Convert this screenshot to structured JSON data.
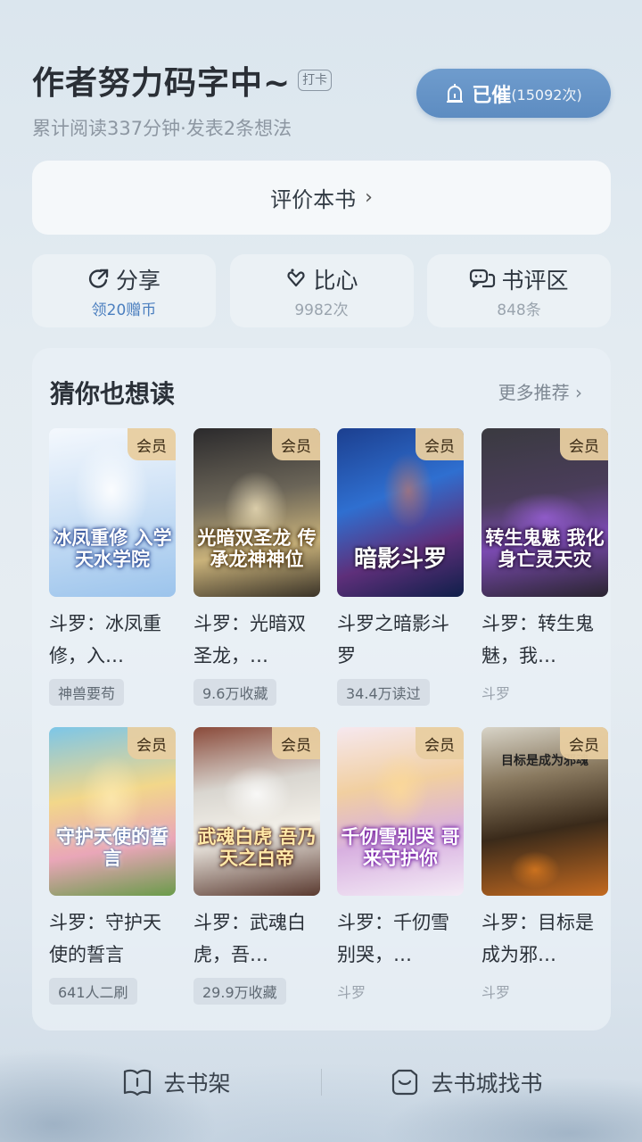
{
  "header": {
    "title": "作者努力码字中~",
    "checkin_badge": "打卡",
    "subtitle": "累计阅读337分钟·发表2条想法",
    "urge": {
      "label": "已催",
      "count": "(15092次)"
    }
  },
  "rate_button": {
    "label": "评价本书",
    "chevron": "›"
  },
  "actions": [
    {
      "icon": "share-icon",
      "label": "分享",
      "sub": "领20赠币"
    },
    {
      "icon": "heart-gesture-icon",
      "label": "比心",
      "sub": "9982次"
    },
    {
      "icon": "comment-icon",
      "label": "书评区",
      "sub": "848条"
    }
  ],
  "recommend": {
    "title": "猜你也想读",
    "more": "更多推荐 ›",
    "vip_label": "会员",
    "books": [
      {
        "name": "斗罗：冰凤重修，入…",
        "cover_text": "冰凤重修 入学天水学院",
        "tag": "神兽要苟",
        "tag_style": "chip"
      },
      {
        "name": "斗罗：光暗双圣龙，…",
        "cover_text": "光暗双圣龙 传承龙神神位",
        "tag": "9.6万收藏",
        "tag_style": "chip"
      },
      {
        "name": "斗罗之暗影斗罗",
        "cover_text": "暗影斗罗",
        "tag": "34.4万读过",
        "tag_style": "chip"
      },
      {
        "name": "斗罗：转生鬼魅，我…",
        "cover_text": "转生鬼魅 我化身亡灵天灾",
        "tag": "斗罗",
        "tag_style": "plain"
      },
      {
        "name": "斗罗：守护天使的誓言",
        "cover_text": "守护天使的誓言",
        "tag": "641人二刷",
        "tag_style": "chip"
      },
      {
        "name": "斗罗：武魂白虎，吾…",
        "cover_text": "武魂白虎 吾乃天之白帝",
        "tag": "29.9万收藏",
        "tag_style": "chip"
      },
      {
        "name": "斗罗：千仞雪别哭，…",
        "cover_text": "千仞雪别哭 哥来守护你",
        "tag": "斗罗",
        "tag_style": "plain"
      },
      {
        "name": "斗罗：目标是成为邪…",
        "cover_text": "目标是成为邪魂",
        "tag": "斗罗",
        "tag_style": "plain"
      }
    ]
  },
  "bottom_bar": [
    {
      "icon": "bookshelf-icon",
      "label": "去书架"
    },
    {
      "icon": "store-heart-icon",
      "label": "去书城找书"
    }
  ],
  "colors": {
    "accent": "#5d8cc1",
    "vip_badge": "#e8cda0",
    "link_blue": "#4b7fbf"
  }
}
